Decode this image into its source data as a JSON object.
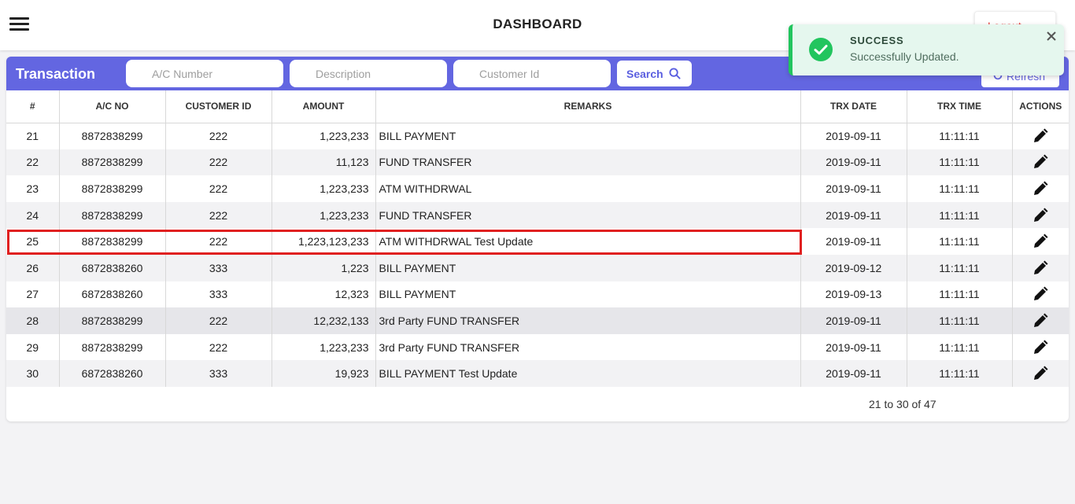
{
  "header": {
    "title": "DASHBOARD",
    "logout_label": "Logout"
  },
  "transaction_panel": {
    "title": "Transaction",
    "filters": {
      "account_number_placeholder": "A/C Number",
      "description_placeholder": "Description",
      "customer_id_placeholder": "Customer Id"
    },
    "search_label": "Search",
    "refresh_label": "Refresh",
    "accent_color": "#6366e1"
  },
  "table": {
    "columns": [
      "#",
      "A/C NO",
      "CUSTOMER ID",
      "AMOUNT",
      "REMARKS",
      "TRX DATE",
      "TRX TIME",
      "ACTIONS"
    ],
    "rows": [
      {
        "index": "21",
        "account_no": "8872838299",
        "customer_id": "222",
        "amount": "1,223,233",
        "remarks": "BILL PAYMENT",
        "trx_date": "2019-09-11",
        "trx_time": "11:11:11"
      },
      {
        "index": "22",
        "account_no": "8872838299",
        "customer_id": "222",
        "amount": "11,123",
        "remarks": "FUND TRANSFER",
        "trx_date": "2019-09-11",
        "trx_time": "11:11:11"
      },
      {
        "index": "23",
        "account_no": "8872838299",
        "customer_id": "222",
        "amount": "1,223,233",
        "remarks": "ATM WITHDRWAL",
        "trx_date": "2019-09-11",
        "trx_time": "11:11:11"
      },
      {
        "index": "24",
        "account_no": "8872838299",
        "customer_id": "222",
        "amount": "1,223,233",
        "remarks": "FUND TRANSFER",
        "trx_date": "2019-09-11",
        "trx_time": "11:11:11"
      },
      {
        "index": "25",
        "account_no": "8872838299",
        "customer_id": "222",
        "amount": "1,223,123,233",
        "remarks": "ATM WITHDRWAL Test Update",
        "trx_date": "2019-09-11",
        "trx_time": "11:11:11"
      },
      {
        "index": "26",
        "account_no": "6872838260",
        "customer_id": "333",
        "amount": "1,223",
        "remarks": "BILL PAYMENT",
        "trx_date": "2019-09-12",
        "trx_time": "11:11:11"
      },
      {
        "index": "27",
        "account_no": "6872838260",
        "customer_id": "333",
        "amount": "12,323",
        "remarks": "BILL PAYMENT",
        "trx_date": "2019-09-13",
        "trx_time": "11:11:11"
      },
      {
        "index": "28",
        "account_no": "8872838299",
        "customer_id": "222",
        "amount": "12,232,133",
        "remarks": "3rd Party FUND TRANSFER",
        "trx_date": "2019-09-11",
        "trx_time": "11:11:11"
      },
      {
        "index": "29",
        "account_no": "8872838299",
        "customer_id": "222",
        "amount": "1,223,233",
        "remarks": "3rd Party FUND TRANSFER",
        "trx_date": "2019-09-11",
        "trx_time": "11:11:11"
      },
      {
        "index": "30",
        "account_no": "6872838260",
        "customer_id": "333",
        "amount": "19,923",
        "remarks": "BILL PAYMENT Test Update",
        "trx_date": "2019-09-11",
        "trx_time": "11:11:11"
      }
    ],
    "action_icon": "pencil-edit-icon"
  },
  "pagination": {
    "summary": "21 to 30 of 47"
  },
  "toast": {
    "title": "SUCCESS",
    "message": "Successfully Updated.",
    "color": "#22c55e"
  }
}
